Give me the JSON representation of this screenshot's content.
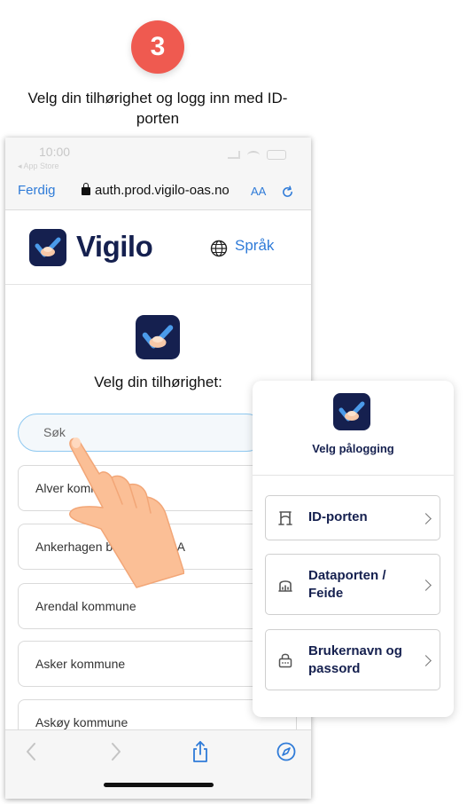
{
  "step_number": "3",
  "instruction": "Velg din tilhørighet og logg inn med ID-porten",
  "browser": {
    "status_time": "10:00",
    "status_back": "◂ App Store",
    "done_label": "Ferdig",
    "url": "auth.prod.vigilo-oas.no",
    "text_size_label": "AA"
  },
  "site": {
    "brand": "Vigilo",
    "language_label": "Språk",
    "select_title": "Velg din tilhørighet:",
    "search_placeholder": "Søk",
    "organizations": [
      "Alver kommune",
      "Ankerhagen barnehage SA",
      "Arendal kommune",
      "Asker kommune",
      "Askøy kommune"
    ]
  },
  "login_panel": {
    "title": "Velg pålogging",
    "options": [
      {
        "label": "ID-porten",
        "icon": "id-porten-icon"
      },
      {
        "label": "Dataporten / Feide",
        "icon": "feide-icon"
      },
      {
        "label": "Brukernavn og passord",
        "icon": "password-lock-icon"
      }
    ]
  },
  "colors": {
    "brand_navy": "#15204f",
    "link_blue": "#2f7bd8",
    "step_badge": "#ef5a50",
    "search_border": "#8ec8f0"
  }
}
